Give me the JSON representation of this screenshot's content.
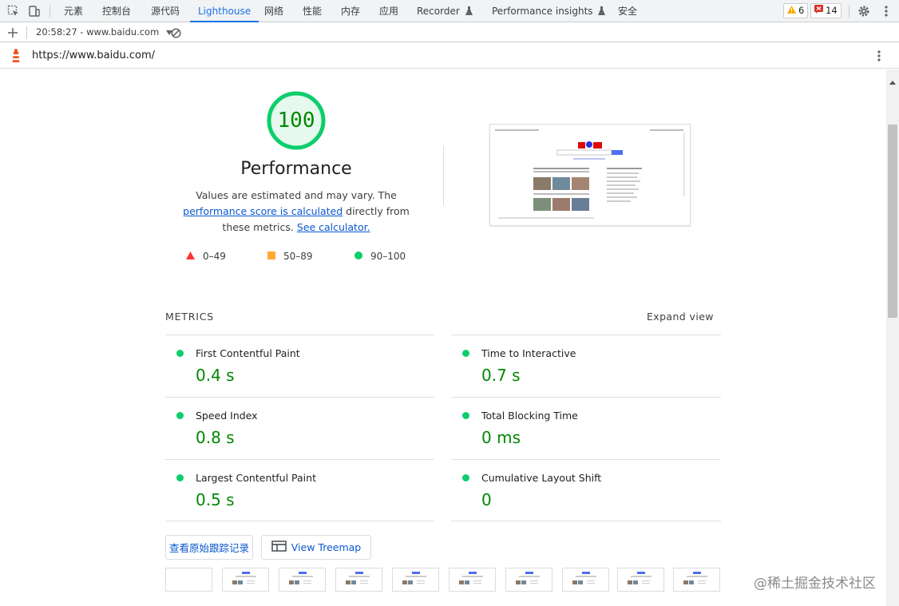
{
  "tabs": [
    {
      "label": "元素",
      "active": false
    },
    {
      "label": "控制台",
      "active": false
    },
    {
      "label": "源代码",
      "active": false
    },
    {
      "label": "Lighthouse",
      "active": true
    },
    {
      "label": "网络",
      "active": false
    },
    {
      "label": "性能",
      "active": false
    },
    {
      "label": "内存",
      "active": false
    },
    {
      "label": "应用",
      "active": false
    },
    {
      "label": "Recorder",
      "active": false
    },
    {
      "label": "Performance insights",
      "active": false
    },
    {
      "label": "安全",
      "active": false
    }
  ],
  "badges": {
    "warnings": "6",
    "errors": "14"
  },
  "toolbar": {
    "report": "20:58:27 - www.baidu.com"
  },
  "url": "https://www.baidu.com/",
  "score": {
    "value": "100",
    "title": "Performance"
  },
  "description": {
    "text1": "Values are estimated and may vary. The ",
    "link1": "performance score is calculated",
    "text2": " directly from these metrics. ",
    "link2": "See calculator."
  },
  "legend": [
    {
      "range": "0–49",
      "shape": "triangle",
      "color": "#ff3333"
    },
    {
      "range": "50–89",
      "shape": "square",
      "color": "#ffaa33"
    },
    {
      "range": "90–100",
      "shape": "circle",
      "color": "#0cce6b"
    }
  ],
  "metrics": {
    "title": "METRICS",
    "expand": "Expand view",
    "items": [
      {
        "label": "First Contentful Paint",
        "value": "0.4 s"
      },
      {
        "label": "Time to Interactive",
        "value": "0.7 s"
      },
      {
        "label": "Speed Index",
        "value": "0.8 s"
      },
      {
        "label": "Total Blocking Time",
        "value": "0 ms"
      },
      {
        "label": "Largest Contentful Paint",
        "value": "0.5 s"
      },
      {
        "label": "Cumulative Layout Shift",
        "value": "0"
      }
    ]
  },
  "buttons": {
    "trace": "查看原始跟踪记录",
    "treemap": "View Treemap"
  },
  "watermark": "@稀土掘金技术社区",
  "colors": {
    "accent": "#1a73e8",
    "pass": "#0cce6b",
    "score_text": "#008800"
  }
}
